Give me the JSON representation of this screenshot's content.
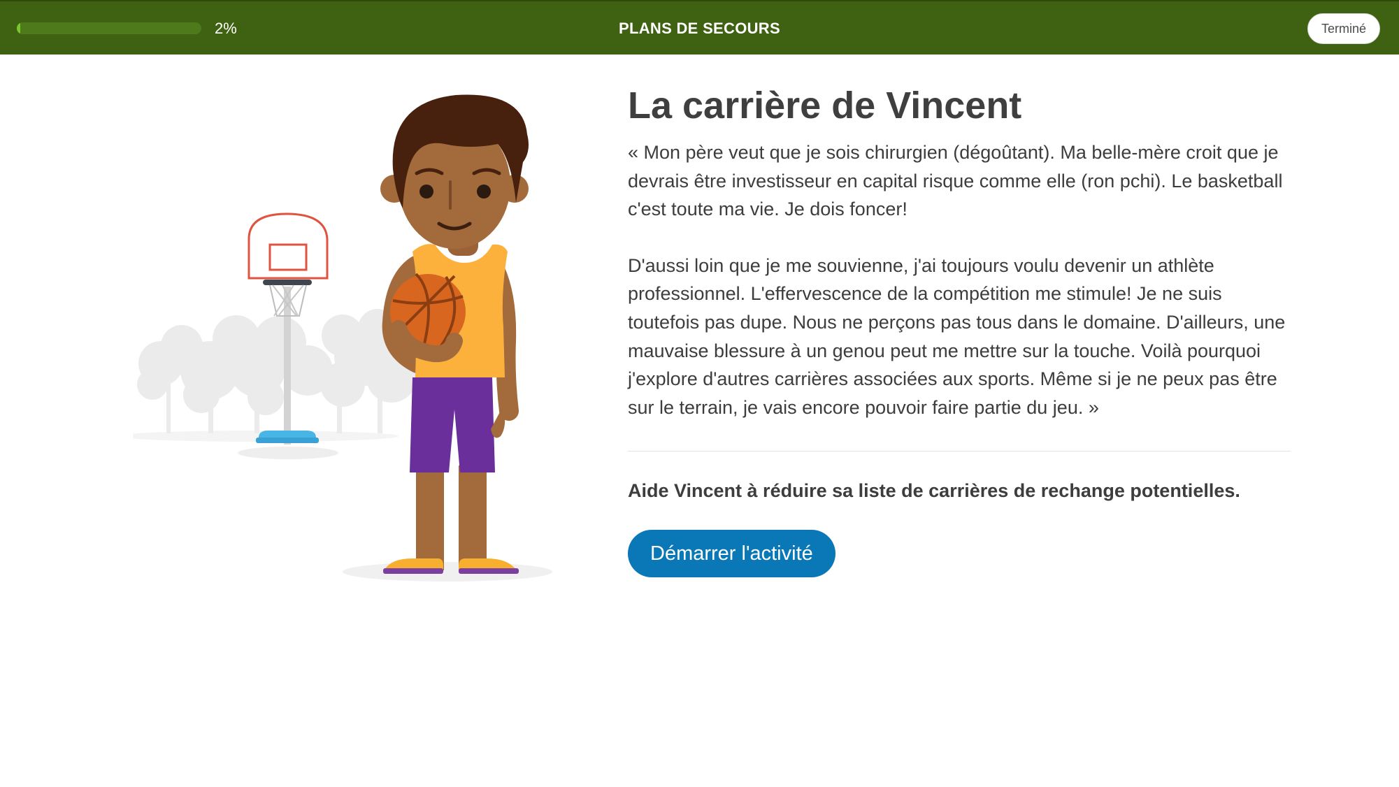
{
  "header": {
    "progress_value": 2,
    "progress_text": "2%",
    "title": "PLANS DE SECOURS",
    "done_label": "Terminé"
  },
  "colors": {
    "topbar": "#3f6212",
    "progress_fill": "#7bc62d",
    "button": "#0a77b6"
  },
  "main": {
    "title": "La carrière de Vincent",
    "paragraphs": [
      "« Mon père veut que je sois chirurgien (dégoûtant). Ma belle-mère croit que je devrais être investisseur en capital risque comme elle (ron pchi). Le basketball c'est toute ma vie. Je dois foncer!",
      "D'aussi loin que je me souvienne, j'ai toujours voulu devenir un athlète professionnel. L'effervescence de la compétition me stimule! Je ne suis toutefois pas dupe. Nous ne perçons pas tous dans le domaine. D'ailleurs, une mauvaise blessure à un genou peut me mettre sur la touche. Voilà pourquoi j'explore d'autres carrières associées aux sports. Même si je ne peux pas être sur le terrain, je vais encore pouvoir faire partie du jeu. »"
    ],
    "prompt": "Aide Vincent à réduire sa liste de carrières de rechange potentielles.",
    "start_label": "Démarrer l'activité"
  },
  "illustration": {
    "subject": "basketball-player",
    "props": [
      "basketball-hoop",
      "basketball",
      "trees"
    ]
  }
}
